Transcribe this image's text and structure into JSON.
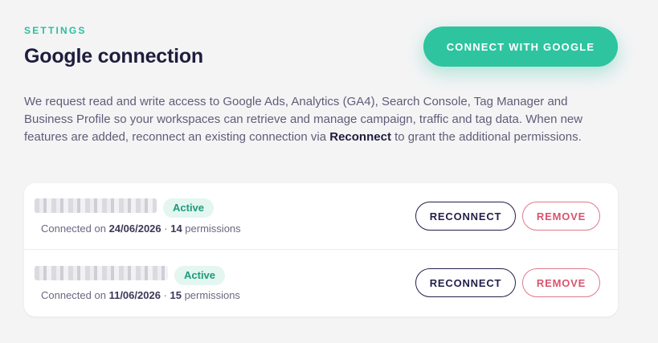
{
  "header": {
    "eyebrow": "SETTINGS",
    "title": "Google connection",
    "connect_label": "CONNECT WITH GOOGLE"
  },
  "description": {
    "before": "We request read and write access to Google Ads, Analytics (GA4), Search Console, Tag Manager and Business Profile so your workspaces can retrieve and manage campaign, traffic and tag data. When new features are added, reconnect an existing connection via ",
    "emphasis": "Reconnect",
    "after": " to grant the additional permissions."
  },
  "connections": [
    {
      "status": "Active",
      "connected_prefix": "Connected on ",
      "date": "24/06/2026",
      "separator": " · ",
      "permissions_count": "14",
      "permissions_suffix": " permissions",
      "reconnect_label": "RECONNECT",
      "remove_label": "REMOVE"
    },
    {
      "status": "Active",
      "connected_prefix": "Connected on ",
      "date": "11/06/2026",
      "separator": " · ",
      "permissions_count": "15",
      "permissions_suffix": " permissions",
      "reconnect_label": "RECONNECT",
      "remove_label": "REMOVE"
    }
  ],
  "colors": {
    "accent": "#2ec4a0",
    "eyebrow": "#2bbf9f",
    "title": "#1f1d3d",
    "badge_bg": "#e3f6f0",
    "badge_text": "#1f9a7a",
    "remove": "#d9546e"
  }
}
